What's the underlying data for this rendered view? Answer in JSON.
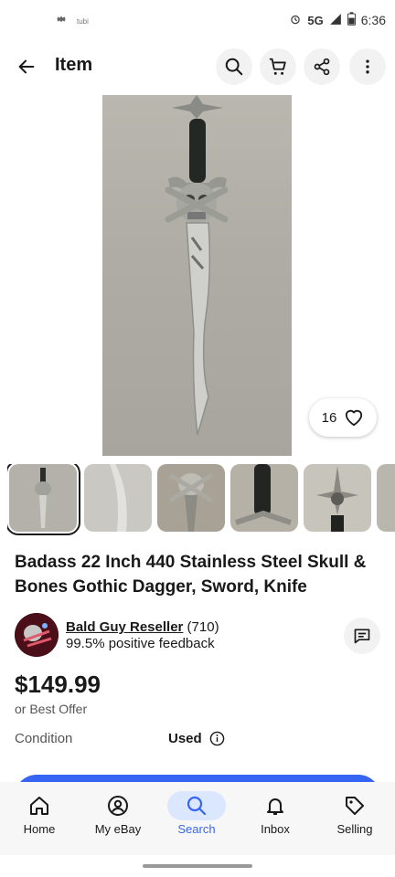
{
  "status": {
    "app": "tubi",
    "network": "5G",
    "time": "6:36"
  },
  "appbar": {
    "title": "Item"
  },
  "hero": {
    "watch_count": "16"
  },
  "listing": {
    "title": "Badass 22 Inch 440 Stainless Steel Skull & Bones Gothic Dagger, Sword, Knife",
    "seller_name": "Bald Guy Reseller",
    "seller_count": " (710)",
    "feedback": "99.5% positive feedback",
    "price": "$149.99",
    "offer": "or Best Offer",
    "condition_label": "Condition",
    "condition_value": "Used"
  },
  "nav": {
    "home": "Home",
    "myebay": "My eBay",
    "search": "Search",
    "inbox": "Inbox",
    "selling": "Selling"
  },
  "colors": {
    "accent": "#3665f3",
    "active_pill": "#dbe6ff"
  }
}
